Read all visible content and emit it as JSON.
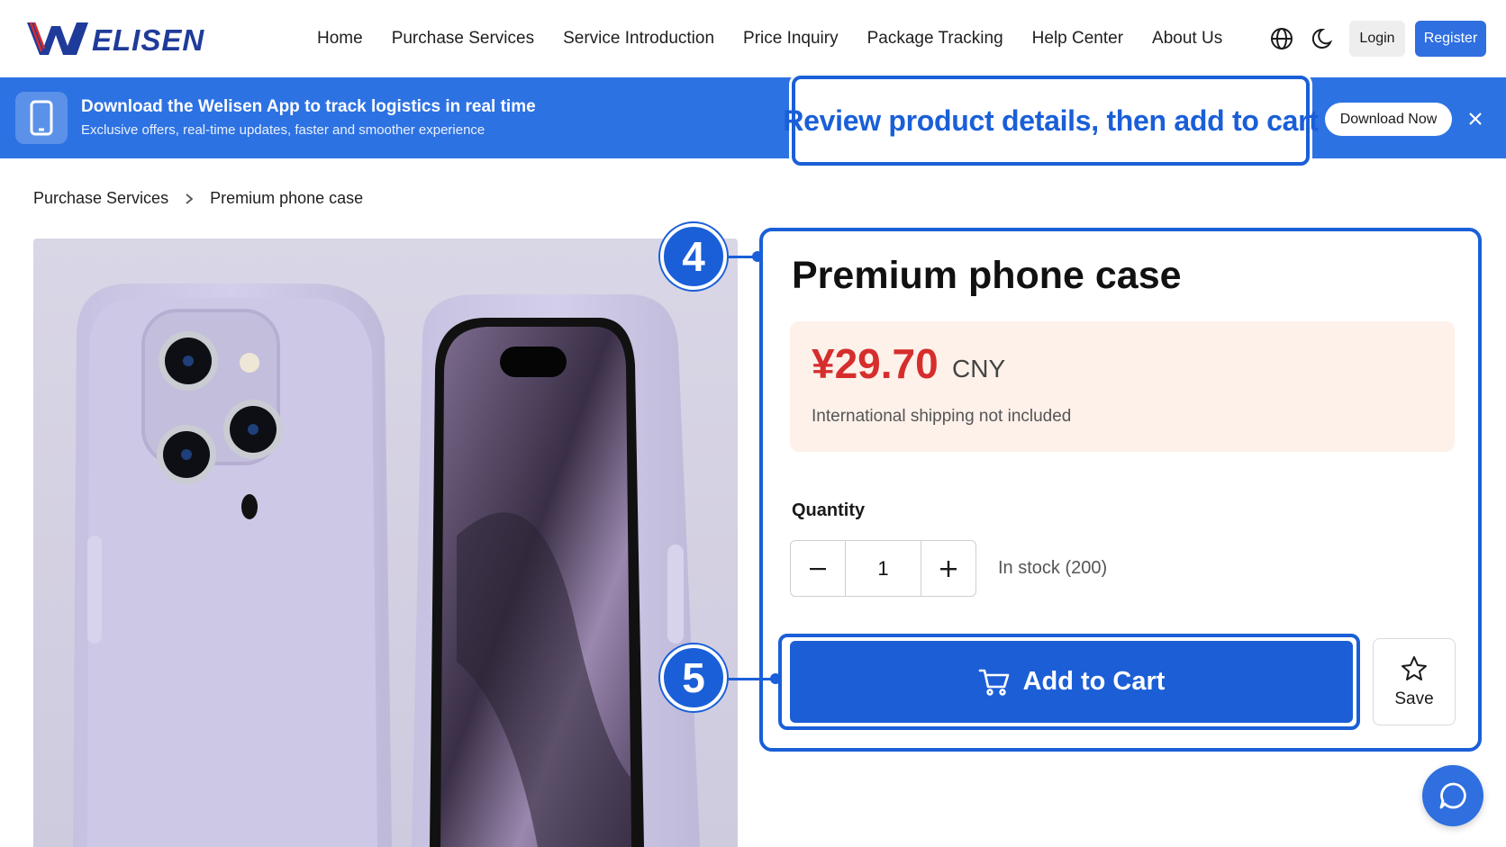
{
  "brand": {
    "logo_text": "ELISEN"
  },
  "nav": {
    "items": [
      {
        "label": "Home"
      },
      {
        "label": "Purchase Services"
      },
      {
        "label": "Service Introduction"
      },
      {
        "label": "Price Inquiry"
      },
      {
        "label": "Package Tracking"
      },
      {
        "label": "Help Center"
      },
      {
        "label": "About Us"
      }
    ],
    "login_label": "Login",
    "register_label": "Register"
  },
  "banner": {
    "title": "Download the Welisen App to track logistics in real time",
    "subtitle": "Exclusive offers, real-time updates, faster and smoother experience",
    "download_label": "Download Now"
  },
  "callout": {
    "text": "Review product details, then add to cart"
  },
  "breadcrumb": {
    "parent": "Purchase Services",
    "current": "Premium phone case"
  },
  "product": {
    "title": "Premium phone case",
    "price": "¥29.70",
    "currency": "CNY",
    "shipping_note": "International shipping not included",
    "quantity_label": "Quantity",
    "quantity": "1",
    "stock": "In stock (200)",
    "add_to_cart_label": "Add to Cart",
    "save_label": "Save"
  },
  "steps": {
    "details": "4",
    "add_to_cart": "5"
  },
  "colors": {
    "primary": "#1a5fd8",
    "banner": "#2d72e3",
    "price": "#d62d2d",
    "price_bg": "#fdf1ea"
  }
}
